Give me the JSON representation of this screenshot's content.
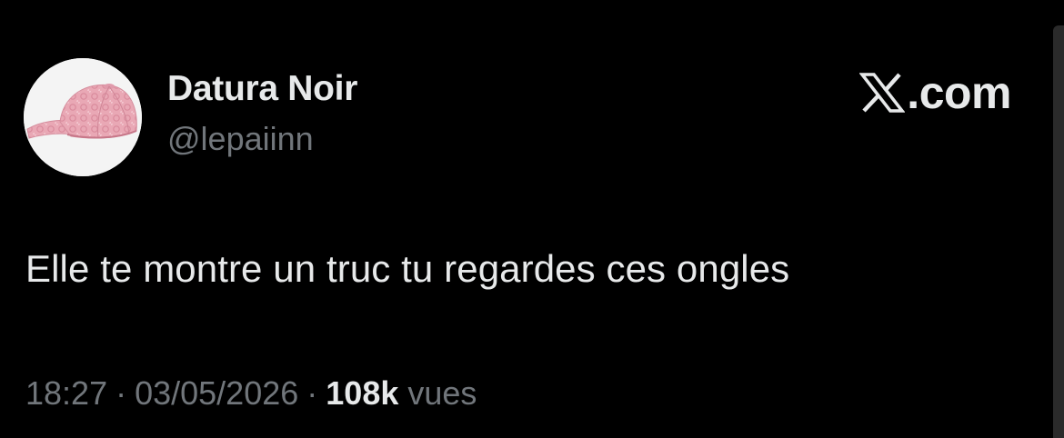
{
  "tweet": {
    "author": {
      "display_name": "Datura Noir",
      "handle": "@lepaiinn",
      "avatar": "pink-monogram-cap"
    },
    "brand": {
      "icon": "x-logo-icon",
      "domain": ".com"
    },
    "text": "Elle te montre un truc tu regardes ces ongles",
    "meta": {
      "time": "18:27",
      "date": "03/05/2026",
      "separator": "·",
      "views_count": "108k",
      "views_label": "vues"
    }
  },
  "colors": {
    "background": "#000000",
    "primary_text": "#e7e9ea",
    "secondary_text": "#71767b",
    "avatar_bg": "#f4f4f4",
    "cap_pink": "#e8a6b4"
  }
}
